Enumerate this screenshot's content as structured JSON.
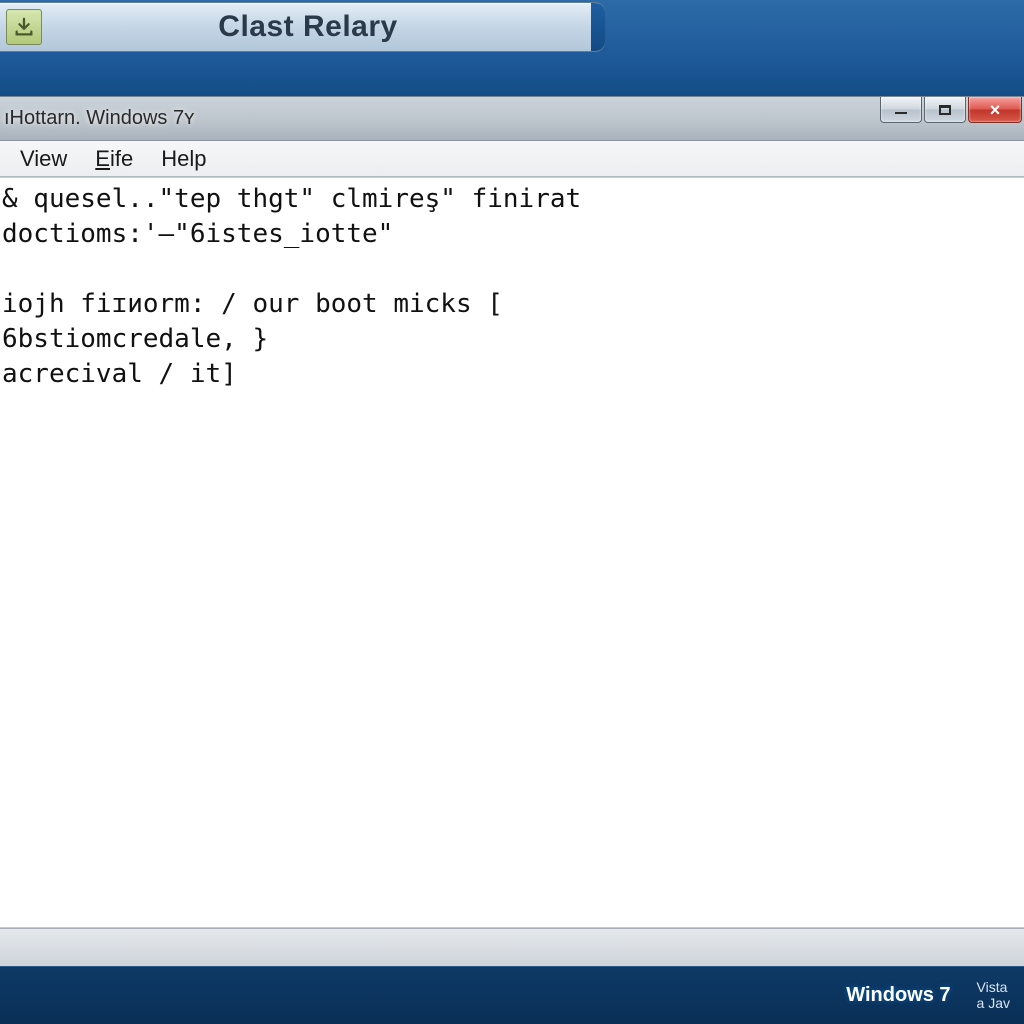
{
  "tab": {
    "title": "Clast Relary",
    "icon_name": "download-icon"
  },
  "window": {
    "title": "ıHottarn. Windows 7ʏ",
    "menu": {
      "view": "View",
      "eife": "Eife",
      "help": "Help"
    },
    "content_lines": [
      "& quesel..\"tep thgt\" clmireş\" finirat",
      "doctioms:'—\"6istes_iotte\"",
      "",
      "iojh fiɪиorm: / our boot micks [",
      "6bstiomcredale, }",
      "acrecival / it]"
    ]
  },
  "taskbar": {
    "os_label": "Windows 7",
    "tray_line1": "Vista",
    "tray_line2": "a Jav"
  }
}
